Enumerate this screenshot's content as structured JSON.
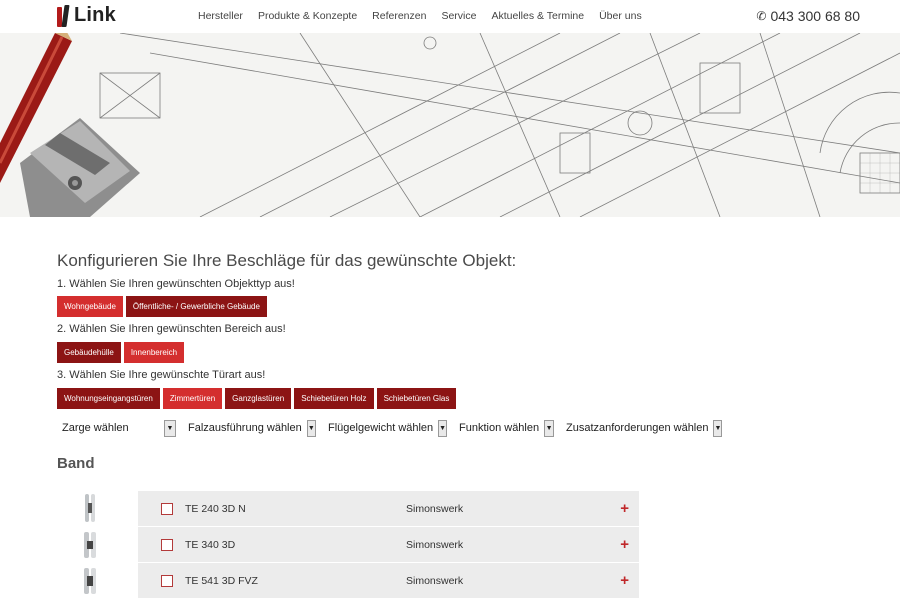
{
  "header": {
    "logo_text": "Link",
    "nav": [
      "Hersteller",
      "Produkte & Konzepte",
      "Referenzen",
      "Service",
      "Aktuelles & Termine",
      "Über uns"
    ],
    "phone": "043 300 68 80"
  },
  "page": {
    "title": "Konfigurieren Sie Ihre Beschläge für das gewünschte Objekt:",
    "step1": "1. Wählen Sie Ihren gewünschten Objekttyp aus!",
    "step1_buttons": [
      "Wohngebäude",
      "Öffentliche- / Gewerbliche Gebäude"
    ],
    "step2": "2. Wählen Sie Ihren gewünschten Bereich aus!",
    "step2_buttons": [
      "Gebäudehülle",
      "Innenbereich"
    ],
    "step3": "3. Wählen Sie Ihre gewünschte Türart aus!",
    "step3_buttons": [
      "Wohnungseingangstüren",
      "Zimmertüren",
      "Ganzglastüren",
      "Schiebetüren Holz",
      "Schiebetüren Glas"
    ],
    "filters": [
      "Zarge wählen",
      "Falzausführung wählen",
      "Flügelgewicht wählen",
      "Funktion wählen",
      "Zusatzanforderungen wählen"
    ],
    "section": "Band",
    "products": [
      {
        "code": "TE 240 3D N",
        "maker": "Simonswerk"
      },
      {
        "code": "TE 340 3D",
        "maker": "Simonswerk"
      },
      {
        "code": "TE 541 3D FVZ",
        "maker": "Simonswerk"
      }
    ]
  },
  "colors": {
    "accent_light": "#d42e2e",
    "accent_dark": "#8c1414",
    "row_bg": "#ececec"
  },
  "icons": {
    "phone": "phone-icon",
    "add": "plus-icon",
    "arrow": "triangle-down-icon"
  }
}
